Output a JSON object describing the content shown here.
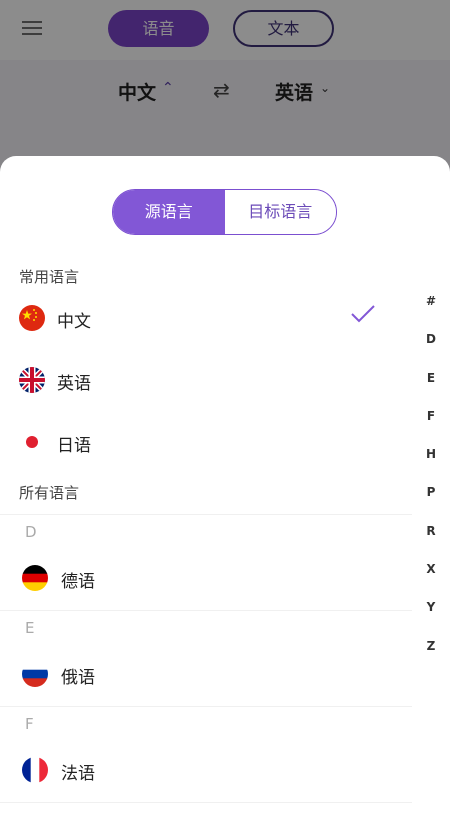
{
  "header": {
    "mode_voice": "语音",
    "mode_text": "文本"
  },
  "language_bar": {
    "source": "中文",
    "target": "英语"
  },
  "sheet": {
    "tab_source": "源语言",
    "tab_target": "目标语言",
    "common_title": "常用语言",
    "common": [
      {
        "label": "中文",
        "flag": "china-flag",
        "selected": true
      },
      {
        "label": "英语",
        "flag": "uk-flag"
      },
      {
        "label": "日语",
        "flag": "japan-flag"
      }
    ],
    "all_title": "所有语言",
    "groups": [
      {
        "letter": "D",
        "label": "德语",
        "flag": "germany-flag"
      },
      {
        "letter": "E",
        "label": "俄语",
        "flag": "russia-flag"
      },
      {
        "letter": "F",
        "label": "法语",
        "flag": "france-flag"
      }
    ],
    "index": [
      "#",
      "D",
      "E",
      "F",
      "H",
      "P",
      "R",
      "X",
      "Y",
      "Z"
    ]
  },
  "colors": {
    "accent": "#8257d6",
    "dark_accent": "#3f3277"
  }
}
